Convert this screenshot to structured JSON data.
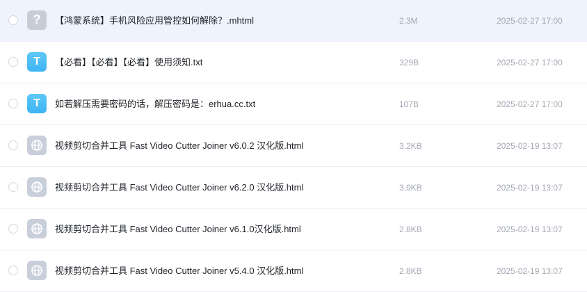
{
  "files": [
    {
      "name": "【鸿蒙系统】手机风险应用管控如何解除？.mhtml",
      "size": "2.3M",
      "date": "2025-02-27 17:00",
      "icon": "unknown-file-icon",
      "glyph": "?"
    },
    {
      "name": "【必看】【必看】【必看】使用须知.txt",
      "size": "329B",
      "date": "2025-02-27 17:00",
      "icon": "text-file-icon",
      "glyph": "T"
    },
    {
      "name": "如若解压需要密码的话，解压密码是：erhua.cc.txt",
      "size": "107B",
      "date": "2025-02-27 17:00",
      "icon": "text-file-icon",
      "glyph": "T"
    },
    {
      "name": "视频剪切合并工具 Fast Video Cutter Joiner v6.0.2 汉化版.html",
      "size": "3.2KB",
      "date": "2025-02-19 13:07",
      "icon": "web-file-icon"
    },
    {
      "name": "视频剪切合并工具 Fast Video Cutter Joiner v6.2.0 汉化版.html",
      "size": "3.9KB",
      "date": "2025-02-19 13:07",
      "icon": "web-file-icon"
    },
    {
      "name": "视频剪切合并工具 Fast Video Cutter Joiner v6.1.0汉化版.html",
      "size": "2.8KB",
      "date": "2025-02-19 13:07",
      "icon": "web-file-icon"
    },
    {
      "name": "视频剪切合并工具 Fast Video Cutter Joiner v5.4.0 汉化版.html",
      "size": "2.8KB",
      "date": "2025-02-19 13:07",
      "icon": "web-file-icon"
    }
  ],
  "colors": {
    "selected_row": "#eef3fe",
    "txt_icon": "#3db4f2",
    "muted_text": "#a3a8b3"
  }
}
